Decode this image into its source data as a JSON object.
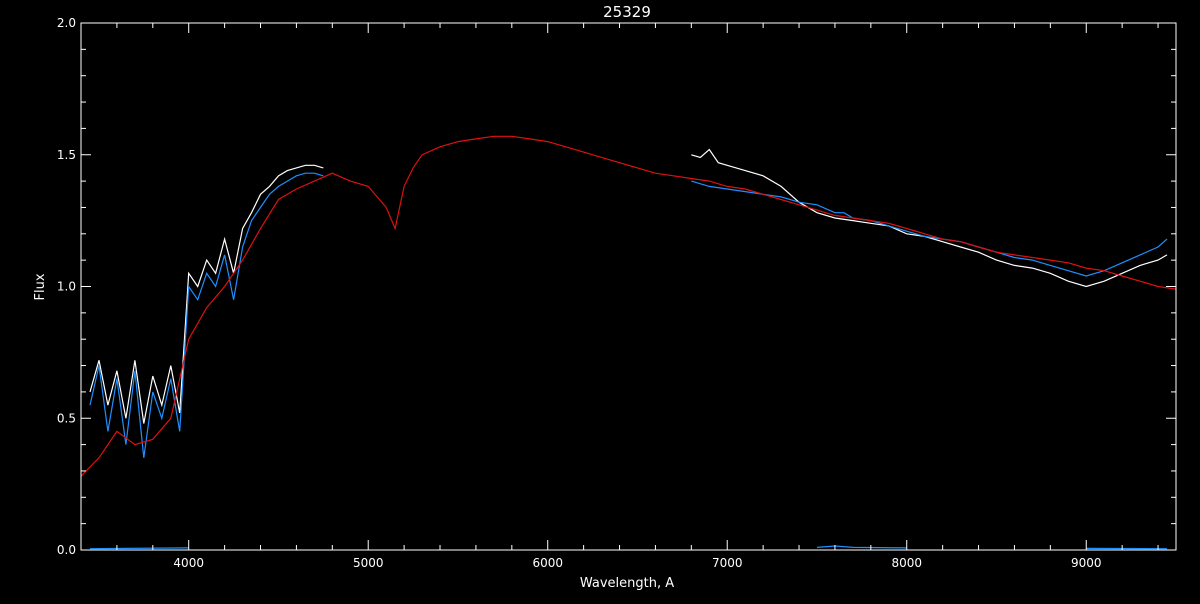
{
  "chart_data": {
    "type": "line",
    "title": "25329",
    "xlabel": "Wavelength, A",
    "ylabel": "Flux",
    "xlim": [
      3400,
      9500
    ],
    "ylim": [
      0.0,
      2.0
    ],
    "x_ticks": [
      4000,
      5000,
      6000,
      7000,
      8000,
      9000
    ],
    "y_ticks": [
      0.0,
      0.5,
      1.0,
      1.5,
      2.0
    ],
    "x_tick_labels": [
      "4000",
      "5000",
      "6000",
      "7000",
      "8000",
      "9000"
    ],
    "y_tick_labels": [
      "0.0",
      "0.5",
      "1.0",
      "1.5",
      "2.0"
    ],
    "grid": false,
    "colors": {
      "background": "#000000",
      "axes": "#ffffff",
      "white_series": "#ffffff",
      "blue_series": "#1e90ff",
      "red_series": "#dd1111"
    },
    "series": [
      {
        "key": "white",
        "color": "#ffffff",
        "x": [
          3450,
          3500,
          3550,
          3600,
          3650,
          3700,
          3750,
          3800,
          3850,
          3900,
          3950,
          4000,
          4050,
          4100,
          4150,
          4200,
          4250,
          4300,
          4350,
          4400,
          4450,
          4500,
          4550,
          4600,
          4650,
          4700,
          4750,
          6800,
          6850,
          6900,
          6950,
          7000,
          7100,
          7200,
          7300,
          7400,
          7500,
          7600,
          7700,
          7800,
          7900,
          8000,
          8100,
          8200,
          8300,
          8400,
          8500,
          8600,
          8700,
          8800,
          8900,
          9000,
          9100,
          9200,
          9300,
          9400,
          9450
        ],
        "y": [
          0.6,
          0.72,
          0.55,
          0.68,
          0.5,
          0.72,
          0.48,
          0.66,
          0.55,
          0.7,
          0.52,
          1.05,
          1.0,
          1.1,
          1.05,
          1.18,
          1.05,
          1.22,
          1.28,
          1.35,
          1.38,
          1.42,
          1.44,
          1.45,
          1.46,
          1.46,
          1.45,
          1.5,
          1.49,
          1.52,
          1.47,
          1.46,
          1.44,
          1.42,
          1.38,
          1.32,
          1.28,
          1.26,
          1.25,
          1.24,
          1.23,
          1.2,
          1.19,
          1.17,
          1.15,
          1.13,
          1.1,
          1.08,
          1.07,
          1.05,
          1.02,
          1.0,
          1.02,
          1.05,
          1.08,
          1.1,
          1.12
        ]
      },
      {
        "key": "blue",
        "color": "#1e90ff",
        "x": [
          3450,
          3500,
          3550,
          3600,
          3650,
          3700,
          3750,
          3800,
          3850,
          3900,
          3950,
          4000,
          4050,
          4100,
          4150,
          4200,
          4250,
          4300,
          4350,
          4400,
          4450,
          4500,
          4550,
          4600,
          4650,
          4700,
          4750,
          6800,
          6900,
          7000,
          7100,
          7200,
          7300,
          7400,
          7500,
          7600,
          7650,
          7700,
          7800,
          7900,
          8000,
          8100,
          8200,
          8300,
          8400,
          8500,
          8600,
          8700,
          8800,
          8900,
          9000,
          9100,
          9200,
          9300,
          9400,
          9450
        ],
        "y": [
          0.55,
          0.7,
          0.45,
          0.65,
          0.4,
          0.68,
          0.35,
          0.6,
          0.5,
          0.65,
          0.45,
          1.0,
          0.95,
          1.05,
          1.0,
          1.12,
          0.95,
          1.15,
          1.25,
          1.3,
          1.35,
          1.38,
          1.4,
          1.42,
          1.43,
          1.43,
          1.42,
          1.4,
          1.38,
          1.37,
          1.36,
          1.35,
          1.34,
          1.32,
          1.31,
          1.28,
          1.28,
          1.26,
          1.25,
          1.23,
          1.21,
          1.19,
          1.18,
          1.17,
          1.15,
          1.13,
          1.11,
          1.1,
          1.08,
          1.06,
          1.04,
          1.06,
          1.09,
          1.12,
          1.15,
          1.18
        ]
      },
      {
        "key": "red",
        "color": "#dd1111",
        "x": [
          3400,
          3500,
          3600,
          3700,
          3800,
          3900,
          4000,
          4100,
          4200,
          4300,
          4400,
          4500,
          4600,
          4700,
          4800,
          4900,
          5000,
          5100,
          5150,
          5200,
          5250,
          5300,
          5400,
          5500,
          5600,
          5700,
          5800,
          5900,
          6000,
          6100,
          6200,
          6300,
          6400,
          6500,
          6600,
          6700,
          6800,
          6900,
          7000,
          7100,
          7200,
          7300,
          7400,
          7500,
          7600,
          7700,
          7800,
          7900,
          8000,
          8100,
          8200,
          8300,
          8400,
          8500,
          8600,
          8700,
          8800,
          8900,
          9000,
          9100,
          9200,
          9300,
          9400,
          9500
        ],
        "y": [
          0.28,
          0.35,
          0.45,
          0.4,
          0.42,
          0.5,
          0.8,
          0.92,
          1.0,
          1.1,
          1.22,
          1.33,
          1.37,
          1.4,
          1.43,
          1.4,
          1.38,
          1.3,
          1.22,
          1.38,
          1.45,
          1.5,
          1.53,
          1.55,
          1.56,
          1.57,
          1.57,
          1.56,
          1.55,
          1.53,
          1.51,
          1.49,
          1.47,
          1.45,
          1.43,
          1.42,
          1.41,
          1.4,
          1.38,
          1.37,
          1.35,
          1.33,
          1.31,
          1.29,
          1.27,
          1.26,
          1.25,
          1.24,
          1.22,
          1.2,
          1.18,
          1.17,
          1.15,
          1.13,
          1.12,
          1.11,
          1.1,
          1.09,
          1.07,
          1.06,
          1.04,
          1.02,
          1.0,
          0.99
        ]
      },
      {
        "key": "blue-error",
        "color": "#1e90ff",
        "x": [
          3450,
          4000,
          4750,
          6800,
          7500,
          7600,
          7700,
          8000,
          9000,
          9450
        ],
        "y": [
          0.005,
          0.008,
          0.006,
          0.008,
          0.01,
          0.015,
          0.01,
          0.008,
          0.006,
          0.005
        ]
      }
    ]
  }
}
